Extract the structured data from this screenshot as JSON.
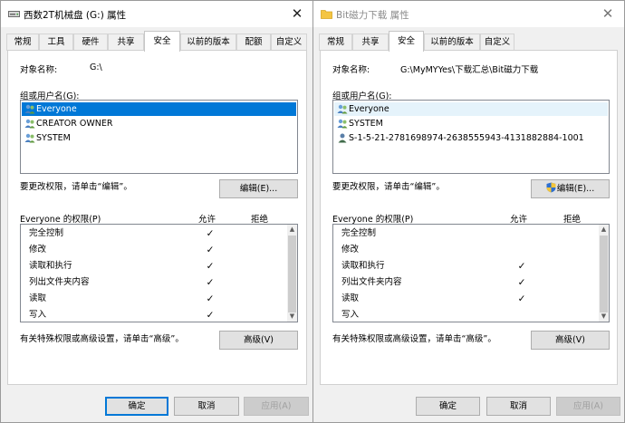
{
  "colors": {
    "selection": "#0078d7",
    "window_bg": "#f0f0f0"
  },
  "icons": {
    "title_drive": "hard-drive-icon",
    "title_folder": "folder-icon",
    "user": "users-group-icon",
    "sid": "unknown-user-icon",
    "shield": "uac-shield-icon"
  },
  "left_dialog": {
    "title": "西数2T机械盘 (G:) 属性",
    "close": "✕",
    "tabs": [
      {
        "label": "常规",
        "active": false
      },
      {
        "label": "工具",
        "active": false
      },
      {
        "label": "硬件",
        "active": false
      },
      {
        "label": "共享",
        "active": false
      },
      {
        "label": "安全",
        "active": true
      },
      {
        "label": "以前的版本",
        "active": false
      },
      {
        "label": "配额",
        "active": false
      },
      {
        "label": "自定义",
        "active": false
      }
    ],
    "object_label": "对象名称:",
    "object_value": "G:\\",
    "groups_label": "组或用户名(G):",
    "groups": [
      {
        "name": "Everyone",
        "state": "selected"
      },
      {
        "name": "CREATOR OWNER",
        "state": "normal"
      },
      {
        "name": "SYSTEM",
        "state": "normal"
      }
    ],
    "edit_hint": "要更改权限，请单击“编辑”。",
    "edit_button": "编辑(E)...",
    "perms_header": "Everyone 的权限(P)",
    "allow_header": "允许",
    "deny_header": "拒绝",
    "permissions": [
      {
        "name": "完全控制",
        "allow": "✓",
        "deny": ""
      },
      {
        "name": "修改",
        "allow": "✓",
        "deny": ""
      },
      {
        "name": "读取和执行",
        "allow": "✓",
        "deny": ""
      },
      {
        "name": "列出文件夹内容",
        "allow": "✓",
        "deny": ""
      },
      {
        "name": "读取",
        "allow": "✓",
        "deny": ""
      },
      {
        "name": "写入",
        "allow": "✓",
        "deny": ""
      }
    ],
    "advanced_hint": "有关特殊权限或高级设置，请单击“高级”。",
    "advanced_button": "高级(V)",
    "ok_button": "确定",
    "cancel_button": "取消",
    "apply_button": "应用(A)"
  },
  "right_dialog": {
    "title": "Bit磁力下载 属性",
    "close": "✕",
    "tabs": [
      {
        "label": "常规",
        "active": false
      },
      {
        "label": "共享",
        "active": false
      },
      {
        "label": "安全",
        "active": true
      },
      {
        "label": "以前的版本",
        "active": false
      },
      {
        "label": "自定义",
        "active": false
      }
    ],
    "object_label": "对象名称:",
    "object_value": "G:\\MyMYYes\\下载汇总\\Bit磁力下载",
    "groups_label": "组或用户名(G):",
    "groups": [
      {
        "name": "Everyone",
        "state": "hover"
      },
      {
        "name": "SYSTEM",
        "state": "normal"
      },
      {
        "name": "S-1-5-21-2781698974-2638555943-4131882884-1001",
        "state": "normal"
      }
    ],
    "edit_hint": "要更改权限，请单击“编辑”。",
    "edit_button": "编辑(E)...",
    "perms_header": "Everyone 的权限(P)",
    "allow_header": "允许",
    "deny_header": "拒绝",
    "permissions": [
      {
        "name": "完全控制",
        "allow": "",
        "deny": ""
      },
      {
        "name": "修改",
        "allow": "",
        "deny": ""
      },
      {
        "name": "读取和执行",
        "allow": "✓",
        "deny": ""
      },
      {
        "name": "列出文件夹内容",
        "allow": "✓",
        "deny": ""
      },
      {
        "name": "读取",
        "allow": "✓",
        "deny": ""
      },
      {
        "name": "写入",
        "allow": "",
        "deny": ""
      }
    ],
    "advanced_hint": "有关特殊权限或高级设置，请单击“高级”。",
    "advanced_button": "高级(V)",
    "ok_button": "确定",
    "cancel_button": "取消",
    "apply_button": "应用(A)"
  }
}
